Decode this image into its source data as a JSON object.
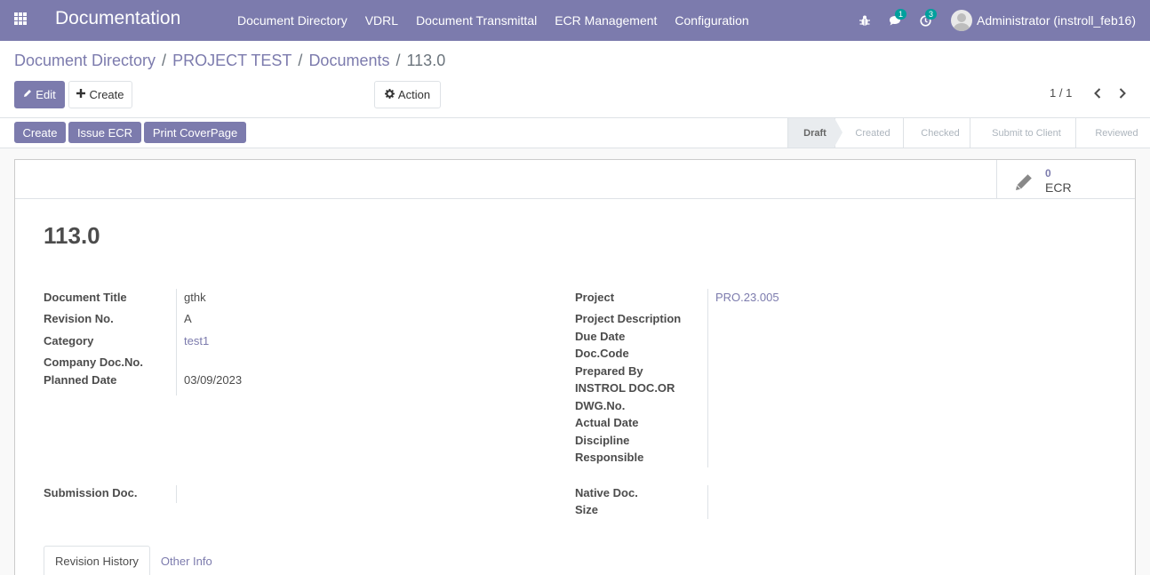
{
  "navbar": {
    "brand": "Documentation",
    "menu": [
      "Document Directory",
      "VDRL",
      "Document Transmittal",
      "ECR Management",
      "Configuration"
    ],
    "chat_count": "1",
    "activity_count": "3",
    "user_name": "Administrator (instroll_feb16)"
  },
  "breadcrumb": {
    "items": [
      "Document Directory",
      "PROJECT TEST",
      "Documents"
    ],
    "separator": "/",
    "current": "113.0"
  },
  "control": {
    "edit_label": "Edit",
    "create_label": "Create",
    "action_label": "Action",
    "pager": "1 / 1"
  },
  "header_buttons": {
    "create": "Create",
    "issue_ecr": "Issue ECR",
    "print_coverpage": "Print CoverPage"
  },
  "stages": {
    "items": [
      "Draft",
      "Created",
      "Checked",
      "Submit to Client",
      "Reviewed"
    ],
    "active": "Draft"
  },
  "smart_button": {
    "value": "0",
    "label": "ECR"
  },
  "record": {
    "title": "113.0"
  },
  "left_fields": {
    "document_title": {
      "label": "Document Title",
      "value": "gthk"
    },
    "revision_no": {
      "label": "Revision No.",
      "value": "A"
    },
    "category": {
      "label": "Category",
      "value": "test1"
    },
    "company_doc_no": {
      "label": "Company Doc.No.",
      "value": ""
    },
    "planned_date": {
      "label": "Planned Date",
      "value": "03/09/2023"
    },
    "submission_doc": {
      "label": "Submission Doc.",
      "value": ""
    }
  },
  "right_fields": {
    "project": {
      "label": "Project",
      "value": "PRO.23.005"
    },
    "project_description": {
      "label": "Project Description"
    },
    "due_date": {
      "label": "Due Date"
    },
    "doc_code": {
      "label": "Doc.Code"
    },
    "prepared_by": {
      "label": "Prepared By"
    },
    "instrol_doc": {
      "label": "INSTROL DOC.OR"
    },
    "dwg_no": {
      "label": "DWG.No."
    },
    "actual_date": {
      "label": "Actual Date"
    },
    "discipline": {
      "label": "Discipline"
    },
    "responsible": {
      "label": "Responsible"
    },
    "native_doc": {
      "label": "Native Doc."
    },
    "size": {
      "label": "Size"
    }
  },
  "tabs": {
    "revision_history": "Revision History",
    "other_info": "Other Info"
  },
  "colors": {
    "brand": "#7c7bad",
    "badge": "#00a09d"
  }
}
